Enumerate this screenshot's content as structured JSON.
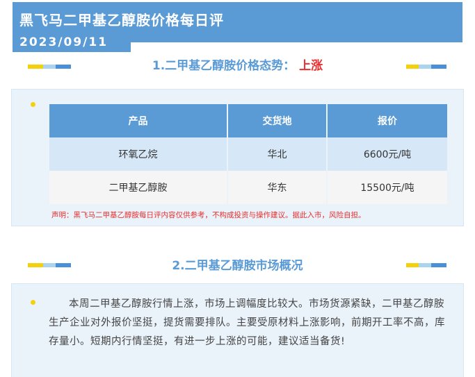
{
  "header": {
    "title": "黑飞马二甲基乙醇胺价格每日评",
    "date": "2023/09/11"
  },
  "section1": {
    "title_prefix": "1.二甲基乙醇胺价格态势：",
    "trend": "上涨"
  },
  "price_table": {
    "columns": [
      "产品",
      "交货地",
      "报价"
    ],
    "rows": [
      [
        "环氧乙烷",
        "华北",
        "6600元/吨"
      ],
      [
        "二甲基乙醇胺",
        "华东",
        "15500元/吨"
      ]
    ]
  },
  "disclaimer": "声明：黑飞马二甲基乙醇胺每日评内容仅供参考，不构成投资与操作建议。据此入市，风险自担。",
  "section2": {
    "title": "2.二甲基乙醇胺市场概况",
    "body": "本周二甲基乙醇胺行情上涨，市场上调幅度比较大。市场货源紧缺，二甲基乙醇胺生产企业对外报价坚挺，提货需要排队。主要受原材料上涨影响，前期开工率不高，库存量小。短期内行情坚挺，有进一步上涨的可能，建议适当备货!"
  },
  "colors": {
    "brand_blue": "#5b9bd5",
    "trend_red": "#e8302f",
    "accent_yellow": "#f5d00c"
  }
}
